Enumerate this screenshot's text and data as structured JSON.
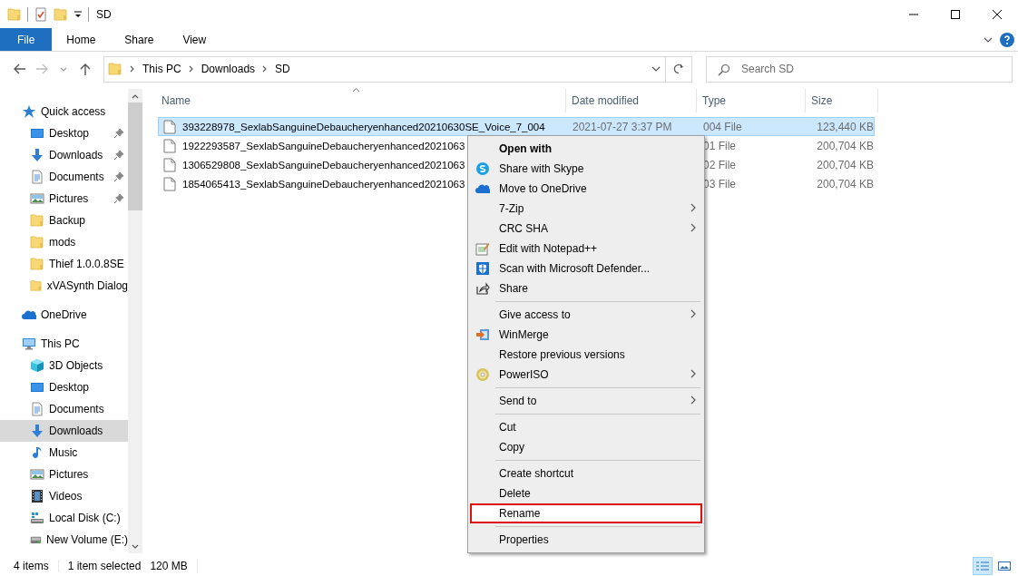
{
  "window": {
    "title": "SD"
  },
  "ribbon": {
    "tabs": [
      {
        "label": "File",
        "kind": "file"
      },
      {
        "label": "Home",
        "kind": "tab"
      },
      {
        "label": "Share",
        "kind": "tab"
      },
      {
        "label": "View",
        "kind": "tab"
      }
    ]
  },
  "address": {
    "crumbs": [
      "This PC",
      "Downloads",
      "SD"
    ]
  },
  "search": {
    "placeholder": "Search SD"
  },
  "nav": [
    {
      "label": "Quick access",
      "kind": "star",
      "selected": false,
      "children": [
        {
          "label": "Desktop",
          "kind": "desktop",
          "pinned": true,
          "selected": false
        },
        {
          "label": "Downloads",
          "kind": "downloads",
          "pinned": true,
          "selected": false
        },
        {
          "label": "Documents",
          "kind": "documents",
          "pinned": true,
          "selected": false
        },
        {
          "label": "Pictures",
          "kind": "pictures",
          "pinned": true,
          "selected": false
        },
        {
          "label": "Backup",
          "kind": "folder",
          "pinned": false,
          "selected": false
        },
        {
          "label": "mods",
          "kind": "folder",
          "pinned": false,
          "selected": false
        },
        {
          "label": "Thief 1.0.0.8SE",
          "kind": "folder",
          "pinned": false,
          "selected": false
        },
        {
          "label": "xVASynth Dialog",
          "kind": "folder",
          "pinned": false,
          "selected": false
        }
      ]
    },
    {
      "label": "OneDrive",
      "kind": "cloud",
      "selected": false
    },
    {
      "label": "This PC",
      "kind": "pc",
      "selected": false,
      "children": [
        {
          "label": "3D Objects",
          "kind": "cube",
          "selected": false
        },
        {
          "label": "Desktop",
          "kind": "desktop",
          "selected": false
        },
        {
          "label": "Documents",
          "kind": "documents",
          "selected": false
        },
        {
          "label": "Downloads",
          "kind": "downloads",
          "selected": true
        },
        {
          "label": "Music",
          "kind": "music",
          "selected": false
        },
        {
          "label": "Pictures",
          "kind": "pictures",
          "selected": false
        },
        {
          "label": "Videos",
          "kind": "videos",
          "selected": false
        },
        {
          "label": "Local Disk (C:)",
          "kind": "disk",
          "selected": false
        },
        {
          "label": "New Volume (E:)",
          "kind": "drive",
          "selected": false
        }
      ]
    }
  ],
  "columns": [
    {
      "label": "Name",
      "sorted": true
    },
    {
      "label": "Date modified",
      "sorted": false
    },
    {
      "label": "Type",
      "sorted": false
    },
    {
      "label": "Size",
      "sorted": false
    }
  ],
  "files": [
    {
      "name": "393228978_SexlabSanguineDebaucheryenhanced20210630SE_Voice_7_004",
      "date": "2021-07-27 3:37 PM",
      "type": "004 File",
      "size": "123,440 KB",
      "selected": true
    },
    {
      "name": "1922293587_SexlabSanguineDebaucheryenhanced2021063",
      "type": "01 File",
      "size": "200,704 KB",
      "selected": false
    },
    {
      "name": "1306529808_SexlabSanguineDebaucheryenhanced2021063",
      "type": "02 File",
      "size": "200,704 KB",
      "selected": false
    },
    {
      "name": "1854065413_SexlabSanguineDebaucheryenhanced2021063",
      "type": "03 File",
      "size": "200,704 KB",
      "selected": false
    }
  ],
  "context_menu": {
    "items": [
      {
        "label": "Open with",
        "kind": "plain",
        "default": true,
        "submenu": false,
        "hovered": false,
        "annotated": false
      },
      {
        "label": "Share with Skype",
        "kind": "skype",
        "default": false,
        "submenu": false,
        "hovered": false,
        "annotated": false
      },
      {
        "label": "Move to OneDrive",
        "kind": "onedrive",
        "default": false,
        "submenu": false,
        "hovered": false,
        "annotated": false
      },
      {
        "label": "7-Zip",
        "kind": "plain",
        "default": false,
        "submenu": true,
        "hovered": false,
        "annotated": false
      },
      {
        "label": "CRC SHA",
        "kind": "plain",
        "default": false,
        "submenu": true,
        "hovered": false,
        "annotated": false
      },
      {
        "label": "Edit with Notepad++",
        "kind": "notepad",
        "default": false,
        "submenu": false,
        "hovered": false,
        "annotated": false
      },
      {
        "label": "Scan with Microsoft Defender...",
        "kind": "defender",
        "default": false,
        "submenu": false,
        "hovered": false,
        "annotated": false
      },
      {
        "label": "Share",
        "kind": "share",
        "default": false,
        "submenu": false,
        "hovered": false,
        "annotated": false
      },
      {
        "kind": "separator"
      },
      {
        "label": "Give access to",
        "kind": "plain",
        "default": false,
        "submenu": true,
        "hovered": false,
        "annotated": false
      },
      {
        "label": "WinMerge",
        "kind": "winmerge",
        "default": false,
        "submenu": false,
        "hovered": false,
        "annotated": false
      },
      {
        "label": "Restore previous versions",
        "kind": "plain",
        "default": false,
        "submenu": false,
        "hovered": false,
        "annotated": false
      },
      {
        "label": "PowerISO",
        "kind": "poweriso",
        "default": false,
        "submenu": true,
        "hovered": false,
        "annotated": false
      },
      {
        "kind": "separator"
      },
      {
        "label": "Send to",
        "kind": "plain",
        "default": false,
        "submenu": true,
        "hovered": false,
        "annotated": false
      },
      {
        "kind": "separator"
      },
      {
        "label": "Cut",
        "kind": "plain",
        "default": false,
        "submenu": false,
        "hovered": false,
        "annotated": false
      },
      {
        "label": "Copy",
        "kind": "plain",
        "default": false,
        "submenu": false,
        "hovered": false,
        "annotated": false
      },
      {
        "kind": "separator"
      },
      {
        "label": "Create shortcut",
        "kind": "plain",
        "default": false,
        "submenu": false,
        "hovered": false,
        "annotated": false
      },
      {
        "label": "Delete",
        "kind": "plain",
        "default": false,
        "submenu": false,
        "hovered": false,
        "annotated": false
      },
      {
        "label": "Rename",
        "kind": "plain",
        "default": false,
        "submenu": false,
        "hovered": true,
        "annotated": true
      },
      {
        "kind": "separator"
      },
      {
        "label": "Properties",
        "kind": "plain",
        "default": false,
        "submenu": false,
        "hovered": false,
        "annotated": false
      }
    ]
  },
  "status_bar": {
    "item_count": "4 items",
    "selection": "1 item selected",
    "selection_size": "120 MB",
    "views": [
      {
        "kind": "details",
        "selected": true
      },
      {
        "kind": "tiles",
        "selected": false
      }
    ]
  }
}
